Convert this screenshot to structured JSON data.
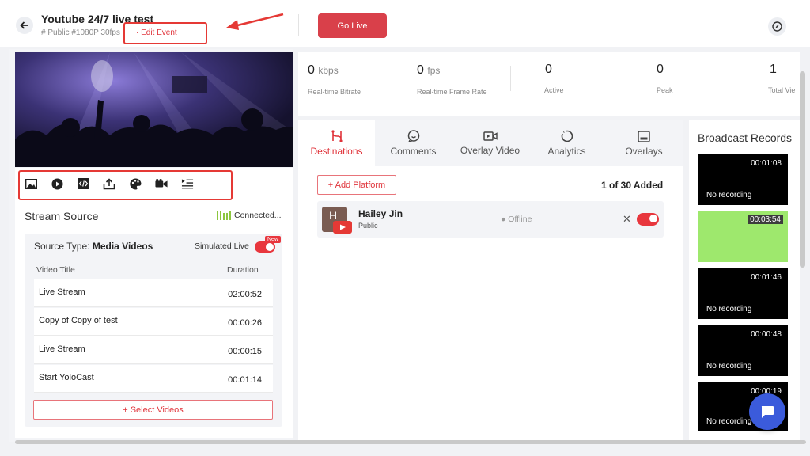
{
  "header": {
    "back_icon": "arrow-left-icon",
    "title": "Youtube 24/7 live test",
    "subtitle": "# Public #1080P 30fps",
    "edit_event": "· Edit Event",
    "go_live": "Go Live",
    "settings_icon": "compass-icon"
  },
  "annotation": {
    "color": "#e53935"
  },
  "toolbar": {
    "icons": [
      "image-icon",
      "play-icon",
      "code-icon",
      "share-icon",
      "palette-icon",
      "camera-icon",
      "playlist-icon"
    ]
  },
  "stream_source": {
    "title": "Stream Source",
    "status": "Connected...",
    "source_type_label": "Source Type:",
    "source_type_value": "Media Videos",
    "simulated_live": "Simulated Live",
    "new_badge": "New",
    "col_title": "Video Title",
    "col_duration": "Duration",
    "videos": [
      {
        "title": "Live Stream",
        "duration": "02:00:52"
      },
      {
        "title": "Copy of Copy of test",
        "duration": "00:00:26"
      },
      {
        "title": "Live Stream",
        "duration": "00:00:15"
      },
      {
        "title": "Start YoloCast",
        "duration": "00:01:14"
      }
    ],
    "select_videos": "+ Select Videos"
  },
  "stats": {
    "bitrate_value": "0",
    "bitrate_unit": "kbps",
    "bitrate_label": "Real-time Bitrate",
    "fps_value": "0",
    "fps_unit": "fps",
    "fps_label": "Real-time Frame Rate",
    "active_value": "0",
    "active_label": "Active",
    "peak_value": "0",
    "peak_label": "Peak",
    "total_value": "1",
    "total_label": "Total Vie"
  },
  "tabs": [
    {
      "label": "Destinations",
      "icon": "destinations-icon",
      "active": true
    },
    {
      "label": "Comments",
      "icon": "comments-icon",
      "active": false
    },
    {
      "label": "Overlay Video",
      "icon": "overlay-video-icon",
      "active": false
    },
    {
      "label": "Analytics",
      "icon": "analytics-icon",
      "active": false
    },
    {
      "label": "Overlays",
      "icon": "overlays-icon",
      "active": false
    }
  ],
  "destinations": {
    "add_platform": "+ Add Platform",
    "count": "1 of 30 Added",
    "items": [
      {
        "initial": "H",
        "name": "Hailey Jin",
        "privacy": "Public",
        "status": "Offline",
        "enabled": true
      }
    ]
  },
  "recordings": {
    "title": "Broadcast Records",
    "items": [
      {
        "duration": "00:01:08",
        "label": "No recording",
        "thumb": "black"
      },
      {
        "duration": "00:03:54",
        "label": "",
        "thumb": "green"
      },
      {
        "duration": "00:01:46",
        "label": "No recording",
        "thumb": "black"
      },
      {
        "duration": "00:00:48",
        "label": "No recording",
        "thumb": "black"
      },
      {
        "duration": "00:00:19",
        "label": "No recording",
        "thumb": "black"
      }
    ]
  },
  "chat": {
    "icon": "chat-icon"
  },
  "colors": {
    "accent": "#e0333a",
    "go_live": "#d9404a",
    "connected": "#8cc63f",
    "chat": "#3b5bdb"
  }
}
